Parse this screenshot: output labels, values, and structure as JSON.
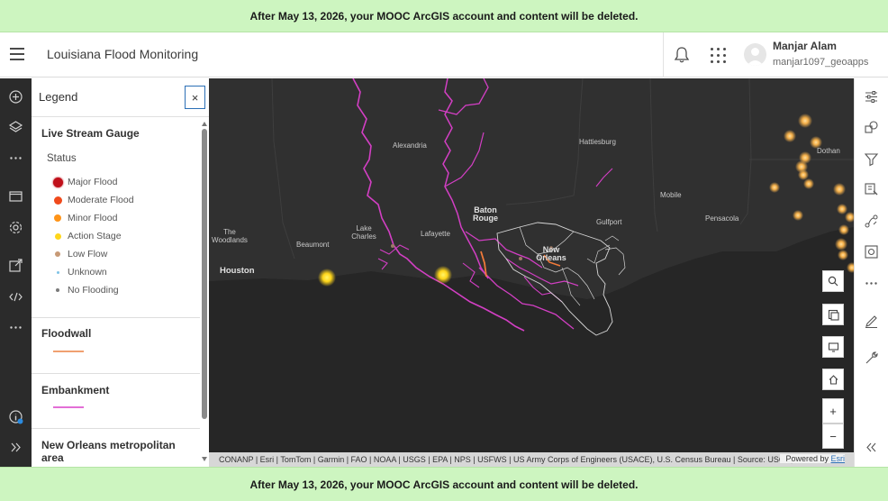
{
  "banner": {
    "text": "After May 13, 2026, your MOOC ArcGIS account and content will be deleted."
  },
  "header": {
    "title": "Louisiana Flood Monitoring",
    "user_name": "Manjar Alam",
    "user_id": "manjar1097_geoapps"
  },
  "legend": {
    "title": "Legend",
    "close_label": "×",
    "sections": {
      "gauge_title": "Live Stream Gauge",
      "status_label": "Status",
      "items": [
        {
          "label": "Major Flood",
          "color": "#c0101a"
        },
        {
          "label": "Moderate Flood",
          "color": "#f04a1c"
        },
        {
          "label": "Minor Flood",
          "color": "#ff9418"
        },
        {
          "label": "Action Stage",
          "color": "#ffd61a"
        },
        {
          "label": "Low Flow",
          "color": "#c79a76"
        },
        {
          "label": "Unknown",
          "color": "#7fc3e6"
        },
        {
          "label": "No Flooding",
          "color": "#7a7a7a"
        }
      ],
      "floodwall_title": "Floodwall",
      "floodwall_color": "#f0a070",
      "embankment_title": "Embankment",
      "embankment_color": "#e36fd6",
      "metro_title": "New Orleans metropolitan area"
    }
  },
  "map": {
    "labels": {
      "alexandria": "Alexandria",
      "hattiesburg": "Hattiesburg",
      "dothan": "Dothan",
      "baton_rouge": "Baton Rouge",
      "mobile": "Mobile",
      "gulfport": "Gulfport",
      "pensacola": "Pensacola",
      "the_woodlands": "The Woodlands",
      "lake_charles": "Lake Charles",
      "beaumont": "Beaumont",
      "lafayette": "Lafayette",
      "new_orleans": "New Orleans",
      "houston": "Houston"
    },
    "attribution": "CONANP | Esri | TomTom | Garmin | FAO | NOAA | USGS | EPA | NPS | USFWS | US Army Corps of Engineers (USACE), U.S. Census Bureau | Source: USGS, NO...",
    "powered_by": "Powered by",
    "powered_by_link": "Esri",
    "zoom_in": "+",
    "zoom_out": "−"
  },
  "colors": {
    "accent": "#2b6fb6",
    "banner_bg": "#cdf5c0",
    "map_bg": "#2c2c2c",
    "river": "#d33fc4"
  }
}
